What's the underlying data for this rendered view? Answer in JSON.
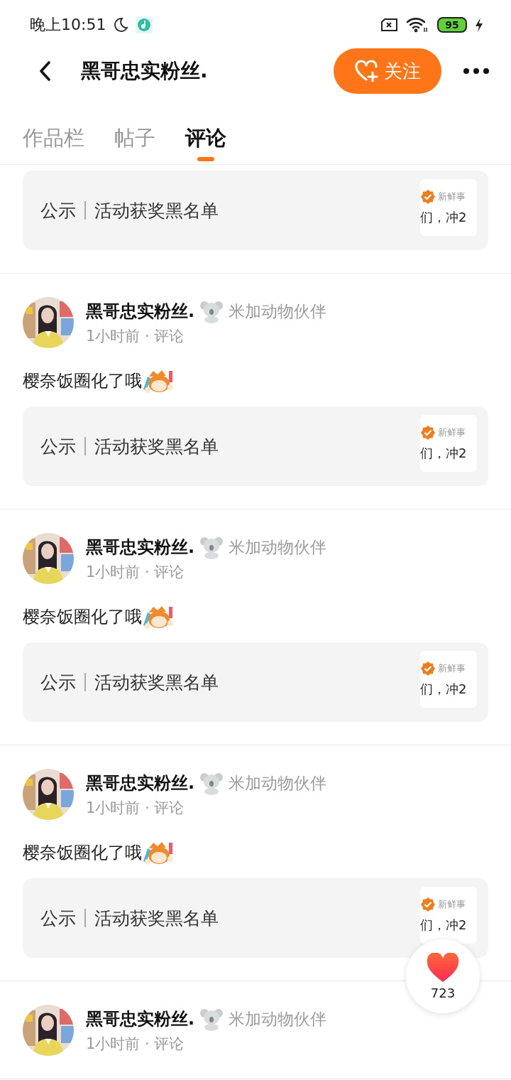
{
  "status_bar": {
    "time": "晚上10:51",
    "battery": "95"
  },
  "header": {
    "title": "黑哥忠实粉丝.",
    "follow_label": "关注"
  },
  "tabs": [
    {
      "label": "作品栏",
      "selected": false
    },
    {
      "label": "帖子",
      "selected": false
    },
    {
      "label": "评论",
      "selected": true
    }
  ],
  "posts": [
    {
      "link_card": {
        "tag": "公示",
        "title": "活动获奖黑名单",
        "thumb_source": "新鲜事",
        "thumb_text": "们，冲2"
      }
    },
    {
      "author": "黑哥忠实粉丝.",
      "badge": "米加动物伙伴",
      "meta": "1小时前 · 评论",
      "text": "樱奈饭圈化了哦",
      "link_card": {
        "tag": "公示",
        "title": "活动获奖黑名单",
        "thumb_source": "新鲜事",
        "thumb_text": "们，冲2"
      }
    },
    {
      "author": "黑哥忠实粉丝.",
      "badge": "米加动物伙伴",
      "meta": "1小时前 · 评论",
      "text": "樱奈饭圈化了哦",
      "link_card": {
        "tag": "公示",
        "title": "活动获奖黑名单",
        "thumb_source": "新鲜事",
        "thumb_text": "们，冲2"
      }
    },
    {
      "author": "黑哥忠实粉丝.",
      "badge": "米加动物伙伴",
      "meta": "1小时前 · 评论",
      "text": "樱奈饭圈化了哦",
      "link_card": {
        "tag": "公示",
        "title": "活动获奖黑名单",
        "thumb_source": "新鲜事",
        "thumb_text": "们，冲2"
      }
    },
    {
      "author": "黑哥忠实粉丝.",
      "badge": "米加动物伙伴",
      "meta": "1小时前 · 评论"
    }
  ],
  "like_fab": {
    "count": "723"
  }
}
